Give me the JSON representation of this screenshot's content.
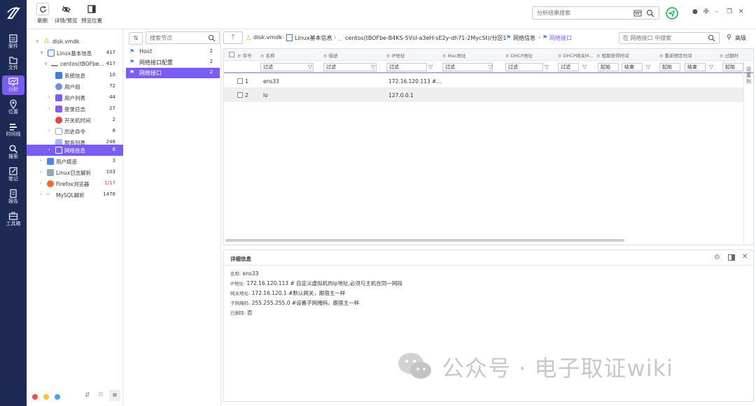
{
  "toolbar": {
    "refresh": "刷新",
    "detail_preview": "详情/预览",
    "preview_position": "预览位置",
    "search_placeholder": "分析结果搜索"
  },
  "leftnav": [
    {
      "label": "案件",
      "icon": "case-icon"
    },
    {
      "label": "文件",
      "icon": "file-icon"
    },
    {
      "label": "分析",
      "icon": "analysis-icon",
      "active": true
    },
    {
      "label": "位置",
      "icon": "location-icon"
    },
    {
      "label": "时间线",
      "icon": "timeline-icon"
    },
    {
      "label": "搜索",
      "icon": "search-icon"
    },
    {
      "label": "笔记",
      "icon": "note-icon"
    },
    {
      "label": "报告",
      "icon": "report-icon"
    },
    {
      "label": "工具箱",
      "icon": "toolbox-icon"
    }
  ],
  "tree": {
    "root": "disk.vmdk",
    "items": [
      {
        "label": "Linux基本信息",
        "count": "417"
      },
      {
        "label": "centos(tBOFbe...",
        "count": "417"
      },
      {
        "label": "系统信息",
        "count": "10"
      },
      {
        "label": "用户组",
        "count": "72"
      },
      {
        "label": "用户列表",
        "count": "44"
      },
      {
        "label": "登录日志",
        "count": "27"
      },
      {
        "label": "开关机时间",
        "count": "2"
      },
      {
        "label": "历史命令",
        "count": "8"
      },
      {
        "label": "服务列表",
        "count": "248"
      },
      {
        "label": "网络信息",
        "count": "6"
      },
      {
        "label": "用户痕迹",
        "count": "3"
      },
      {
        "label": "Linux日志解析",
        "count": "103"
      },
      {
        "label": "Firefox浏览器",
        "count": "1/17"
      },
      {
        "label": "MySQL解析",
        "count": "1476"
      }
    ]
  },
  "categories": {
    "search_placeholder": "搜索节点",
    "items": [
      {
        "label": "Host",
        "count": "2"
      },
      {
        "label": "网络接口配置",
        "count": "2"
      },
      {
        "label": "网络接口",
        "count": "2"
      }
    ]
  },
  "breadcrumb": {
    "items": [
      "disk.vmdk",
      "Linux基本信息",
      "centos(tBOFbe-B4KS-5VsI-a3eH-sE2y-dh71-2MycSt)/分区1",
      "网络信息",
      "网络接口"
    ],
    "search_placeholder": "在 网络接口 中搜索",
    "advanced": "高级"
  },
  "grid": {
    "headers": [
      "序号",
      "名称",
      "描述",
      "IP地址",
      "Mac地址",
      "DHCP地址",
      "DHCP网关M...",
      "租期获得时间",
      "重新预定时间",
      "过期时"
    ],
    "filter_label": "过滤",
    "start_label": "起始",
    "end_label": "结束",
    "rows": [
      {
        "index": "1",
        "name": "ens33",
        "ip": "172.16.120.113 #..."
      },
      {
        "index": "2",
        "name": "lo",
        "ip": "127.0.0.1"
      }
    ],
    "side_label": [
      "设",
      "置",
      "列"
    ]
  },
  "detail": {
    "title": "详细信息",
    "rows": [
      {
        "key": "名称:",
        "value": "ens33"
      },
      {
        "key": "IP地址:",
        "value": "172.16.120.113 # 自定义虚拟机的ip地址,必须与主机在同一网段"
      },
      {
        "key": "网关地址:",
        "value": "172.16.120.1 #默认网关，跟宿主一样"
      },
      {
        "key": "子网掩码:",
        "value": "255.255.255.0 #设置子网掩码，跟宿主一样"
      },
      {
        "key": "已删除:",
        "value": "否"
      }
    ]
  },
  "watermark": "公众号 · 电子取证wiki",
  "colors": {
    "accent": "#7b5cf4",
    "nav_bg": "#1e2a56"
  }
}
